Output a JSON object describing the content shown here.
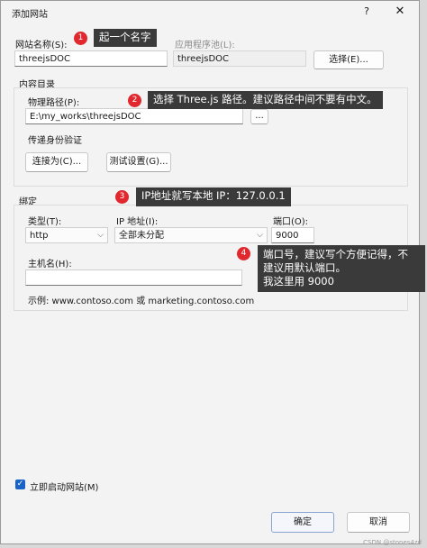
{
  "window": {
    "title": "添加网站",
    "help": "?",
    "close": "✕"
  },
  "site_name": {
    "label": "网站名称(S):",
    "value": "threejsDOC"
  },
  "app_pool": {
    "label": "应用程序池(L):",
    "value": "threejsDOC",
    "select_button": "选择(E)..."
  },
  "content_dir": {
    "title": "内容目录",
    "physical_path_label": "物理路径(P):",
    "physical_path_value": "E:\\my_works\\threejsDOC",
    "browse_button": "...",
    "auth_label": "传递身份验证",
    "connect_button": "连接为(C)...",
    "test_button": "测试设置(G)..."
  },
  "binding": {
    "title": "绑定",
    "type_label": "类型(T):",
    "type_value": "http",
    "ip_label": "IP 地址(I):",
    "ip_value": "全部未分配",
    "port_label": "端口(O):",
    "port_value": "9000",
    "host_label": "主机名(H):",
    "host_value": "",
    "example": "示例: www.contoso.com 或 marketing.contoso.com"
  },
  "start_site": {
    "label": "立即启动网站(M)",
    "checked": true,
    "check_glyph": "✓"
  },
  "footer": {
    "ok": "确定",
    "cancel": "取消"
  },
  "annotations": [
    {
      "num": "1",
      "text": "起一个名字"
    },
    {
      "num": "2",
      "text": "选择 Three.js 路径。建议路径中间不要有中文。"
    },
    {
      "num": "3",
      "text": "IP地址就写本地 IP：127.0.0.1"
    },
    {
      "num": "4",
      "lines": [
        "端口号，建议写个方便记得，不",
        "建议用默认端口。",
        "我这里用 9000"
      ]
    }
  ],
  "watermark": "CSDN @stones4zd"
}
